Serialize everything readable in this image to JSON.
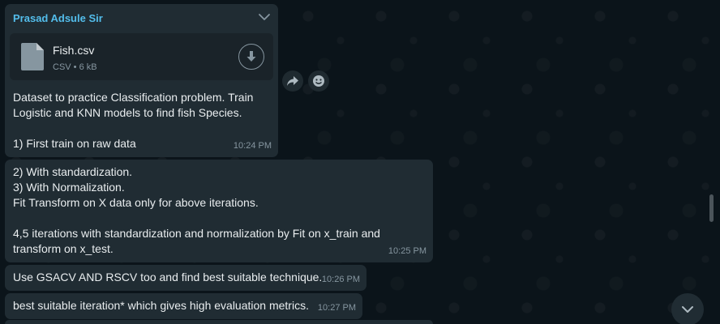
{
  "chat": {
    "sender_name": "Prasad Adsule Sir",
    "file": {
      "name": "Fish.csv",
      "meta": "CSV • 6 kB"
    },
    "messages": [
      {
        "lines": [
          "Dataset to practice Classification problem. Train",
          "Logistic and KNN models to find fish Species.",
          "",
          "1) First train on raw data"
        ],
        "time": "10:24 PM"
      },
      {
        "lines": [
          "2) With standardization.",
          "3) With Normalization.",
          "Fit Transform on X data only for above iterations.",
          "",
          "4,5 iterations with standardization and normalization by Fit on x_train and",
          "transform on x_test."
        ],
        "time": "10:25 PM"
      },
      {
        "lines": [
          "Use GSACV AND RSCV too and find best suitable technique."
        ],
        "time": "10:26 PM"
      },
      {
        "lines": [
          "best suitable iteration* which gives high evaluation metrics."
        ],
        "time": "10:27 PM"
      }
    ]
  },
  "icons": {
    "menu": "chevron-down-icon",
    "document": "document-icon",
    "download": "download-icon",
    "forward": "forward-icon",
    "react": "emoji-icon",
    "scroll": "chevron-down-icon"
  },
  "colors": {
    "background": "#0b141a",
    "bubble": "#202c33",
    "sender": "#53bdeb",
    "meta": "#8696a0"
  }
}
